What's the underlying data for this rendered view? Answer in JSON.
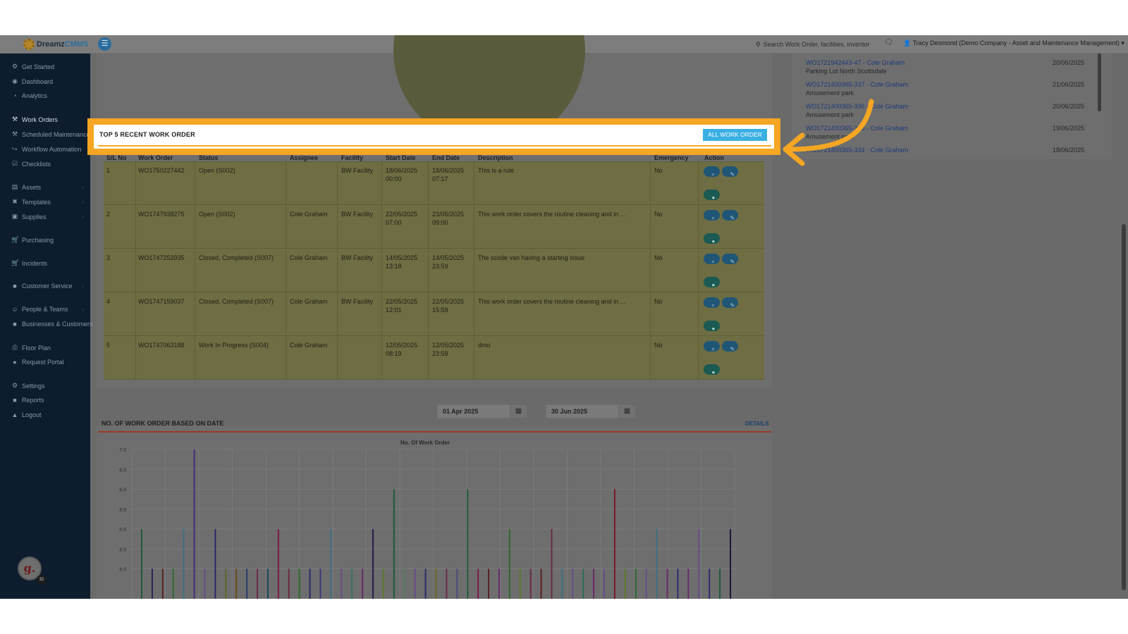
{
  "app": {
    "logo_main": "Dreamz",
    "logo_accent": "CMMS",
    "search_placeholder": "Search Work Order, facilities, inventor",
    "user_label": "Tracy Desmond (Demo Company - Asset and Maintenance Management)"
  },
  "sidebar": {
    "items": [
      {
        "label": "Get Started",
        "icon": "gear-group-icon"
      },
      {
        "label": "Dashboard",
        "icon": "dashboard-icon"
      },
      {
        "label": "Analytics",
        "icon": "analytics-icon"
      },
      {
        "label": "Work Orders",
        "icon": "wrench-icon"
      },
      {
        "label": "Scheduled Maintenance",
        "icon": "wrench-icon"
      },
      {
        "label": "Workflow Automation",
        "icon": "flow-icon"
      },
      {
        "label": "Checklists",
        "icon": "checklist-icon"
      },
      {
        "label": "Assets",
        "icon": "assets-icon"
      },
      {
        "label": "Templates",
        "icon": "templates-icon"
      },
      {
        "label": "Supplies",
        "icon": "supplies-icon"
      },
      {
        "label": "Purchasing",
        "icon": "cart-icon"
      },
      {
        "label": "Incidents",
        "icon": "cart-icon"
      },
      {
        "label": "Customer Service",
        "icon": "document-icon"
      },
      {
        "label": "People & Teams",
        "icon": "people-icon"
      },
      {
        "label": "Businesses & Customers",
        "icon": "camera-icon"
      },
      {
        "label": "Floor Plan",
        "icon": "print-icon"
      },
      {
        "label": "Request Portal",
        "icon": "chat-icon"
      },
      {
        "label": "Settings",
        "icon": "gear-icon"
      },
      {
        "label": "Reports",
        "icon": "document-icon"
      },
      {
        "label": "Logout",
        "icon": "user-icon"
      }
    ],
    "badge_letter": "g.",
    "badge_count": "32"
  },
  "recent_orders": {
    "title": "TOP 5 RECENT WORK ORDER",
    "button": "ALL WORK ORDER",
    "headers": [
      "S/L No",
      "Work Order",
      "Status",
      "Assignee",
      "Facility",
      "Start Date",
      "End Date",
      "Description",
      "Emergency",
      "Action"
    ],
    "rows": [
      {
        "sl": "1",
        "wo": "WO1750227442",
        "status": "Open (S002)",
        "assignee": "",
        "facility": "BW Facility",
        "start": "18/06/2025 00:00",
        "end": "18/06/2025 07:17",
        "desc": "This is a rule",
        "emergency": "No"
      },
      {
        "sl": "2",
        "wo": "WO1747938275",
        "status": "Open (S002)",
        "assignee": "Cole Graham",
        "facility": "BW Facility",
        "start": "22/05/2025 07:00",
        "end": "23/05/2025 09:00",
        "desc": "This work order covers the routine cleaning and in ...",
        "emergency": "No"
      },
      {
        "sl": "3",
        "wo": "WO1747253935",
        "status": "Closed, Completed (S007)",
        "assignee": "Cole Graham",
        "facility": "BW Facility",
        "start": "14/05/2025 13:18",
        "end": "14/05/2025 23:59",
        "desc": "The scode van having a starting issue",
        "emergency": "No"
      },
      {
        "sl": "4",
        "wo": "WO1747159037",
        "status": "Closed, Completed (S007)",
        "assignee": "Cole Graham",
        "facility": "BW Facility",
        "start": "22/05/2025 12:01",
        "end": "22/05/2025 15:59",
        "desc": "This work order covers the routine cleaning and in ...",
        "emergency": "No"
      },
      {
        "sl": "5",
        "wo": "WO1747063188",
        "status": "Work In Progress (S004)",
        "assignee": "Cole Graham",
        "facility": "",
        "start": "12/05/2025 08:19",
        "end": "12/05/2025 23:59",
        "desc": "dmo",
        "emergency": "No"
      }
    ]
  },
  "right_list": [
    {
      "link": "WO1721942443-47 - Cole Graham",
      "sub": "Parking Lot North Scottsdale",
      "date": "20/06/2025"
    },
    {
      "link": "WO1721400365-337 - Cole Graham",
      "sub": "Amusement park",
      "date": "21/06/2025"
    },
    {
      "link": "WO1721400365-336 - Cole Graham",
      "sub": "Amusement park",
      "date": "20/06/2025"
    },
    {
      "link": "WO1721400365-335 - Cole Graham",
      "sub": "Amusement park",
      "date": "19/06/2025"
    },
    {
      "link": "WO1721400365-334 - Cole Graham",
      "sub": "",
      "date": "18/06/2025"
    }
  ],
  "date_range": {
    "from": "01 Apr 2025",
    "to": "30 Jun 2025"
  },
  "chart_section": {
    "title": "NO. OF WORK ORDER BASED ON DATE",
    "details": "DETAILS"
  },
  "chart_data": {
    "type": "bar",
    "title": "No. Of Work Order",
    "xlabel": "",
    "ylabel": "",
    "ylim": [
      3.8,
      7.0
    ],
    "yticks": [
      "7.0",
      "6.5",
      "6.0",
      "5.5",
      "5.0",
      "4.5",
      "4.0"
    ],
    "grid": true,
    "values": [
      5,
      4,
      4,
      4,
      5,
      7,
      4,
      5,
      4,
      4,
      4,
      4,
      4,
      5,
      4,
      4,
      4,
      4,
      5,
      4,
      4,
      4,
      5,
      4,
      6,
      4,
      4,
      4,
      4,
      4,
      4,
      6,
      4,
      4,
      4,
      5,
      4,
      4,
      4,
      5,
      4,
      4,
      4,
      4,
      4,
      6,
      4,
      4,
      4,
      5,
      4,
      4,
      4,
      5,
      4,
      4,
      5
    ],
    "colors": [
      "#1f5a3a",
      "#27235a",
      "#5a2020",
      "#2f6a2f",
      "#3c6f82",
      "#4a2a7a",
      "#6a4a8a",
      "#2a2a6a",
      "#5a6a2a",
      "#6a4a1a",
      "#2a3a6a",
      "#6a2a4a",
      "#1a4a5a",
      "#7a1a4a",
      "#6a2a3a",
      "#2f6a2f",
      "#2a2a6a",
      "#3a3a7a",
      "#3c6f82",
      "#6a4a8a",
      "#3a6f6a",
      "#6a2a6a",
      "#2a1a4a",
      "#5a7a2a",
      "#1f5a3a",
      "#5a7a5a",
      "#6a4a8a",
      "#2a2a6a",
      "#6a6a2a",
      "#6a2a4a",
      "#4a4a7a",
      "#1f5a3a",
      "#7a1a4a",
      "#5a2020",
      "#6a2a6a",
      "#2f6a2f",
      "#5a7a2a",
      "#6a2a4a",
      "#5a2020",
      "#6a2a4a",
      "#3c6f82",
      "#6a4a8a",
      "#2a6a5a",
      "#6a2a6a",
      "#6a4a8a",
      "#7a1a2a",
      "#5a7a2a",
      "#2f6a2f",
      "#6a4a8a",
      "#3c6f82",
      "#6a2a6a",
      "#2a2a6a",
      "#6a2a6a",
      "#6a4a8a",
      "#2a2a6a",
      "#1f5a3a",
      "#1a1a3a"
    ]
  }
}
